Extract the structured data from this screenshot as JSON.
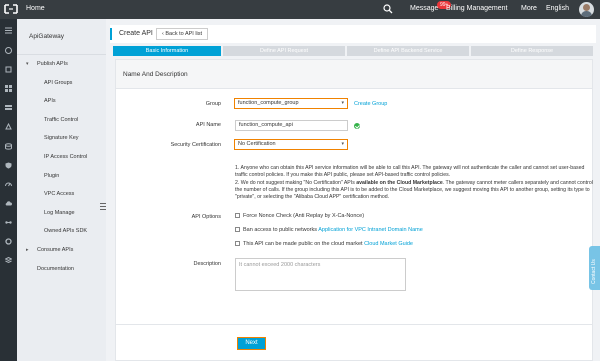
{
  "topbar": {
    "home": "Home",
    "message": "Message",
    "message_badge": "99+",
    "billing": "Billing Management",
    "more": "More",
    "language": "English"
  },
  "sidebar": {
    "title": "ApiGateway",
    "items": [
      {
        "label": "Publish APIs"
      },
      {
        "label": "API Groups"
      },
      {
        "label": "APIs"
      },
      {
        "label": "Traffic Control"
      },
      {
        "label": "Signature Key"
      },
      {
        "label": "IP Access Control"
      },
      {
        "label": "Plugin"
      },
      {
        "label": "VPC Access"
      },
      {
        "label": "Log Manage"
      },
      {
        "label": "Owned APIs SDK"
      },
      {
        "label": "Consume APIs"
      },
      {
        "label": "Documentation"
      }
    ]
  },
  "header": {
    "title": "Create API",
    "back_label": "Back to API list"
  },
  "steps": [
    "Basic Information",
    "Define API Request",
    "Define API Backend Service",
    "Define Response"
  ],
  "panel": {
    "title": "Name And Description"
  },
  "form": {
    "group_label": "Group",
    "group_value": "function_compute_group",
    "create_group": "Create Group",
    "api_name_label": "API Name",
    "api_name_value": "function_compute_api",
    "security_label": "Security Certification",
    "security_value": "No Certification",
    "note1": "1. Anyone who can obtain this API service information will be able to call this API. The gateway will not authenticate the caller and cannot set user-based traffic control policies. If you make this API public, please set API-based traffic control policies.",
    "note2_a": "2. We do not suggest making \"No Certification\" APIs ",
    "note2_b": "available on the Cloud Marketplace",
    "note2_c": ". The gateway cannot meter callers separately and cannot control the number of calls. If the group including this API is to be added to the Cloud Marketplace, we suggest moving this API to another group, setting its type to \"private\", or selecting the \"Alibaba Cloud APP\" certification method.",
    "api_options_label": "API Options",
    "option1": "Force Nonce Check (Anti Replay by X-Ca-Nonce)",
    "option2_text": "Ban access to public networks",
    "option2_link": "Application for VPC Intranet Domain Name",
    "option3_text": "This API can be made public on the cloud market",
    "option3_link": "Cloud Market Guide",
    "description_label": "Description",
    "description_placeholder": "It cannot exceed 2000 characters"
  },
  "footer": {
    "next_label": "Next"
  },
  "contact_tab": "Contact Us",
  "colors": {
    "accent": "#00a1d6",
    "highlight": "#f08200",
    "topbar": "#373d41"
  }
}
